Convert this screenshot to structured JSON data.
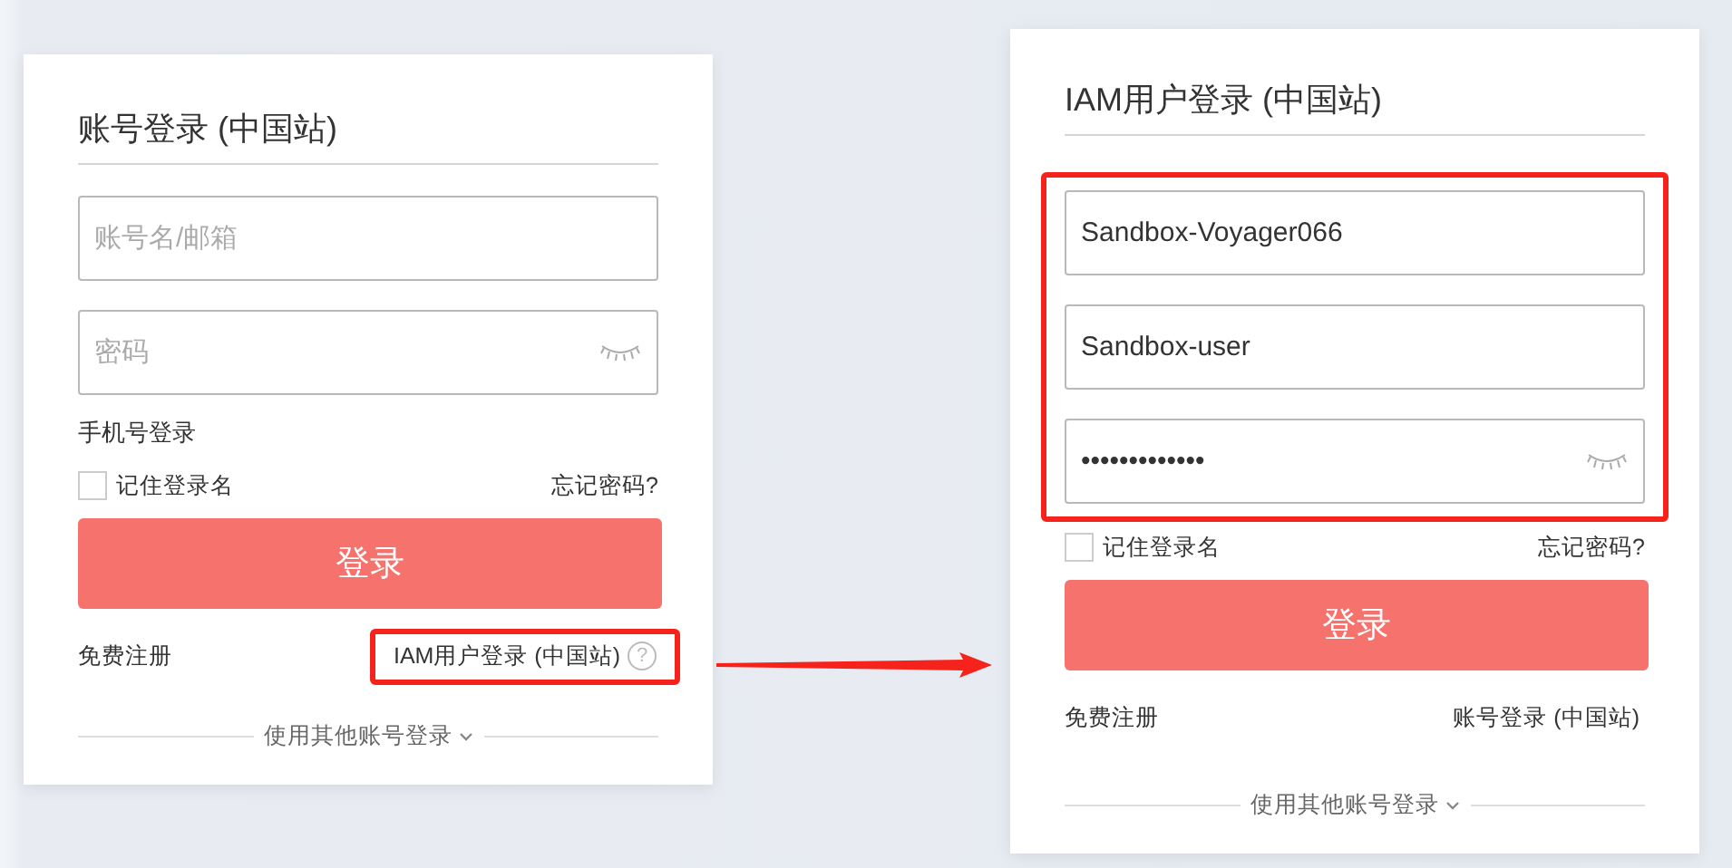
{
  "panels": [
    {
      "title": "账号登录 (中国站)",
      "fields_highlighted": false,
      "fields": [
        {
          "kind": "text",
          "placeholder": "账号名/邮箱"
        },
        {
          "kind": "password",
          "placeholder": "密码"
        }
      ],
      "phone_login_link": "手机号登录",
      "remember": {
        "label": "记住登录名",
        "checked": false
      },
      "forgot_link": "忘记密码?",
      "submit": "登录",
      "register_link": "免费注册",
      "switch_link": {
        "label": "IAM用户登录 (中国站)",
        "highlighted": true,
        "help_symbol": "?"
      },
      "other_login": "使用其他账号登录"
    },
    {
      "title": "IAM用户登录 (中国站)",
      "fields_highlighted": true,
      "fields": [
        {
          "kind": "text",
          "value": "Sandbox-Voyager066"
        },
        {
          "kind": "text",
          "value": "Sandbox-user"
        },
        {
          "kind": "password",
          "value": "•••••••••••••"
        }
      ],
      "remember": {
        "label": "记住登录名",
        "checked": false
      },
      "forgot_link": "忘记密码?",
      "submit": "登录",
      "register_link": "免费注册",
      "switch_link": {
        "label": "账号登录 (中国站)",
        "highlighted": false
      },
      "other_login": "使用其他账号登录"
    }
  ]
}
